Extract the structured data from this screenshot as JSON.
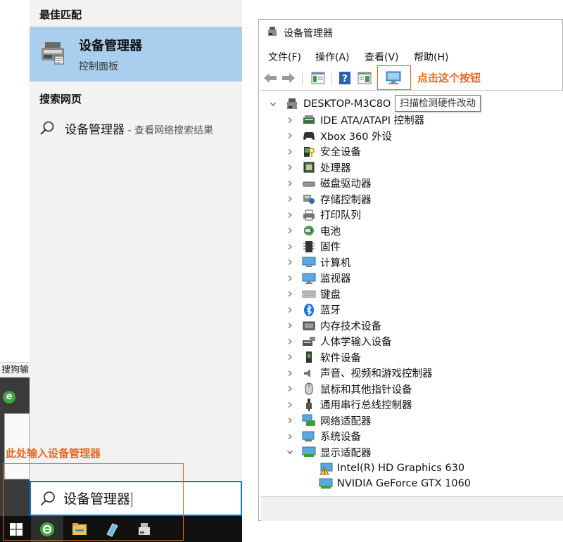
{
  "start_menu": {
    "best_match_header": "最佳匹配",
    "best_match": {
      "title": "设备管理器",
      "subtitle": "控制面板"
    },
    "web_header": "搜索网页",
    "web_item": {
      "title": "设备管理器",
      "suffix": " - 查看网络搜索结果"
    },
    "search_box": {
      "value": "设备管理器"
    },
    "annotation": "此处输入设备管理器"
  },
  "desktop": {
    "ime_bar_text": "搜狗输"
  },
  "taskbar": {
    "items": [
      "windows-start-icon",
      "ie-icon",
      "file-explorer-icon",
      "tablet-icon",
      "device-manager-icon"
    ]
  },
  "device_manager": {
    "title": "设备管理器",
    "menu": [
      "文件(F)",
      "操作(A)",
      "查看(V)",
      "帮助(H)"
    ],
    "annotation": "点击这个按钮",
    "tooltip": "扫描检测硬件改动",
    "root": "DESKTOP-M3C8O",
    "categories": [
      {
        "label": "IDE ATA/ATAPI 控制器",
        "icon": "ide-controller-icon"
      },
      {
        "label": "Xbox 360 外设",
        "icon": "gamepad-icon"
      },
      {
        "label": "安全设备",
        "icon": "security-device-icon"
      },
      {
        "label": "处理器",
        "icon": "processor-icon"
      },
      {
        "label": "磁盘驱动器",
        "icon": "disk-drive-icon"
      },
      {
        "label": "存储控制器",
        "icon": "storage-controller-icon"
      },
      {
        "label": "打印队列",
        "icon": "printer-icon"
      },
      {
        "label": "电池",
        "icon": "battery-icon"
      },
      {
        "label": "固件",
        "icon": "firmware-icon"
      },
      {
        "label": "计算机",
        "icon": "computer-icon"
      },
      {
        "label": "监视器",
        "icon": "monitor-icon"
      },
      {
        "label": "键盘",
        "icon": "keyboard-icon"
      },
      {
        "label": "蓝牙",
        "icon": "bluetooth-icon"
      },
      {
        "label": "内存技术设备",
        "icon": "memory-device-icon"
      },
      {
        "label": "人体学输入设备",
        "icon": "hid-icon"
      },
      {
        "label": "软件设备",
        "icon": "software-device-icon"
      },
      {
        "label": "声音、视频和游戏控制器",
        "icon": "speaker-icon"
      },
      {
        "label": "鼠标和其他指针设备",
        "icon": "mouse-icon"
      },
      {
        "label": "通用串行总线控制器",
        "icon": "usb-icon"
      },
      {
        "label": "网络适配器",
        "icon": "network-adapter-icon"
      },
      {
        "label": "系统设备",
        "icon": "system-device-icon"
      },
      {
        "label": "显示适配器",
        "icon": "display-adapter-icon",
        "expanded": true
      }
    ],
    "display_adapters": [
      {
        "label": "Intel(R) HD Graphics 630",
        "icon": "warning-display-icon"
      },
      {
        "label": "NVIDIA GeForce GTX 1060",
        "icon": "display-adapter-icon"
      }
    ]
  },
  "colors": {
    "accent": "#0078d7",
    "annotation": "#e8661f",
    "highlight": "#aacfee"
  }
}
